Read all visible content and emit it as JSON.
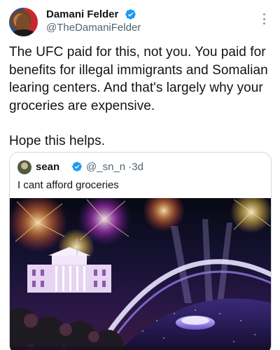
{
  "author": {
    "name": "Damani Felder",
    "handle": "@TheDamaniFelder",
    "verified": true
  },
  "tweet": {
    "paragraphs": [
      "The UFC paid for this, not you. You paid for benefits for illegal immigrants and Somalian learing centers. And that's largely why your groceries are expensive.",
      "Hope this helps."
    ]
  },
  "quoted_tweet": {
    "name": "sean",
    "handle": "@_sn_n",
    "separator": "·",
    "time": "3d",
    "text": "I cant afford groceries",
    "verified": true
  },
  "colors": {
    "verified_blue": "#1d9bf0",
    "secondary_text": "#536471",
    "border": "#cfd9de"
  },
  "icons": {
    "verified": "verified-badge-icon",
    "more": "more-options-icon"
  }
}
